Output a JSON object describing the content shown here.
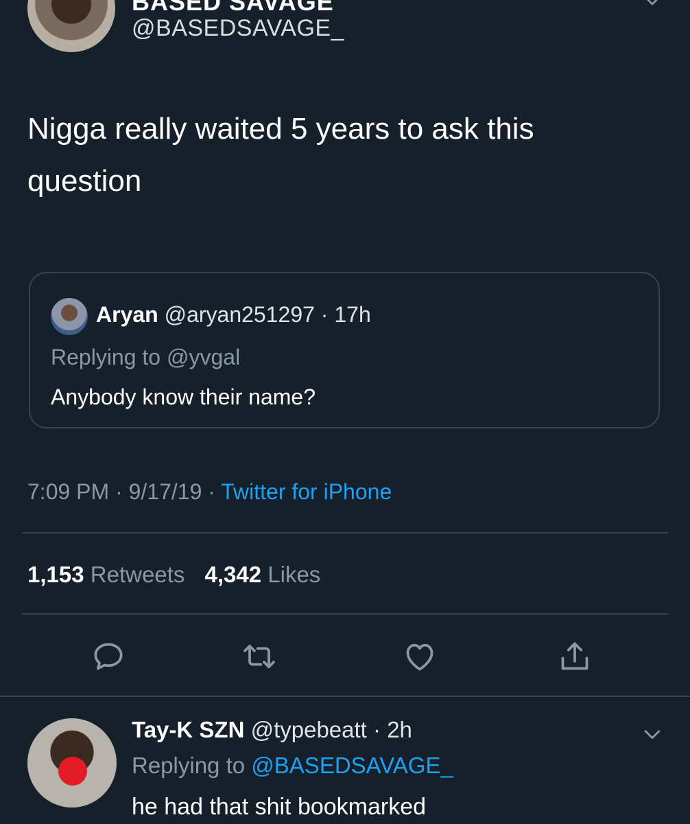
{
  "main_tweet": {
    "display_name": "BASED SAVAGE",
    "handle": "@BASEDSAVAGE_",
    "text_line1": "Nigga really waited 5 years to ask this",
    "text_line2": "question",
    "avatar_icon": "user-avatar",
    "menu_icon": "chevron-down-icon"
  },
  "quoted_tweet": {
    "name": "Aryan",
    "handle": "@aryan251297",
    "separator": "·",
    "time": "17h",
    "replying_to": "Replying to @yvgal",
    "text": "Anybody know their name?"
  },
  "meta": {
    "time": "7:09 PM",
    "separator": "·",
    "date": "9/17/19",
    "source": "Twitter for iPhone",
    "source_color": "#1da1f2"
  },
  "stats": {
    "retweets_count": "1,153",
    "retweets_label": "Retweets",
    "likes_count": "4,342",
    "likes_label": "Likes"
  },
  "actions": [
    {
      "icon": "reply-icon"
    },
    {
      "icon": "retweet-icon"
    },
    {
      "icon": "heart-icon"
    },
    {
      "icon": "share-icon"
    }
  ],
  "reply": {
    "name": "Tay-K SZN",
    "handle": "@typebeatt",
    "separator": "·",
    "time": "2h",
    "replying_prefix": "Replying to",
    "replying_mention": "@BASEDSAVAGE_",
    "text": "he had that shit bookmarked"
  },
  "colors": {
    "background": "#15202b",
    "border": "#38444d",
    "secondary_text": "#8899a6",
    "accent": "#1da1f2"
  }
}
